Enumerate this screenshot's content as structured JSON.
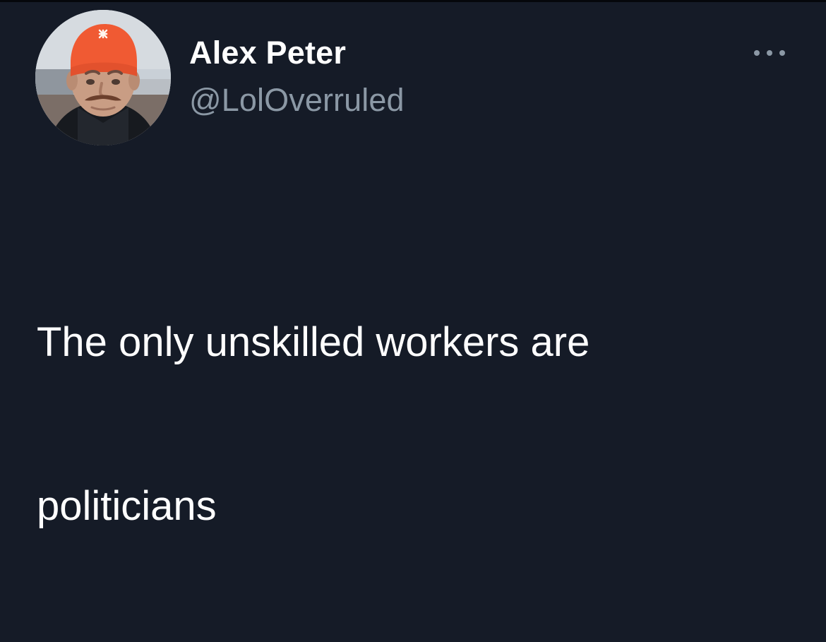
{
  "tweet": {
    "author": {
      "display_name": "Alex Peter",
      "handle": "@LolOverruled",
      "avatar_icon": "profile-photo-man-orange-beanie"
    },
    "more_icon": "more-horizontal-icon",
    "text_lines": [
      "The only unskilled workers are",
      "politicians"
    ]
  },
  "colors": {
    "background": "#151b27",
    "primary_text": "#ffffff",
    "secondary_text": "#8b98a5",
    "beanie": "#f05a33"
  }
}
